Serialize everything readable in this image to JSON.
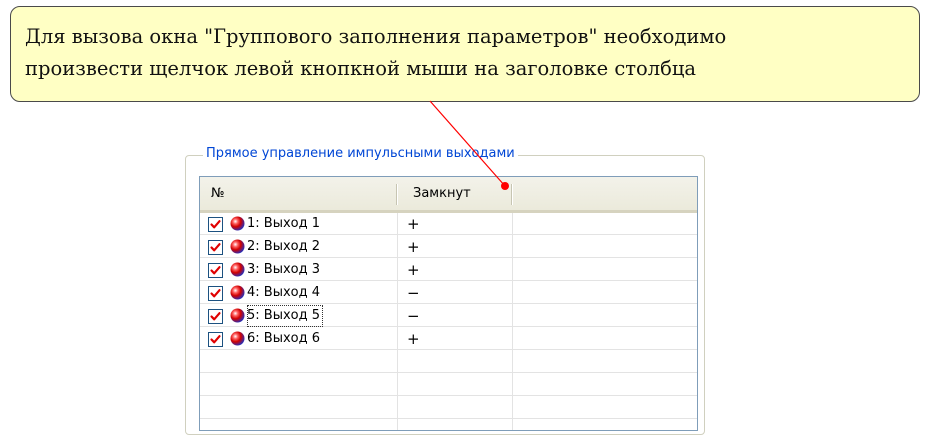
{
  "callout": {
    "line1": "Для вызова окна \"Группового заполнения параметров\" необходимо",
    "line2": "произвести щелчок левой кнопкной мыши на заголовке столбца",
    "background": "#ffffc4",
    "pointer_color": "#ff0000"
  },
  "groupbox": {
    "title": "Прямое управление импульсными выходами",
    "title_color": "#0046d5"
  },
  "grid": {
    "columns": [
      {
        "label": "№"
      },
      {
        "label": "Замкнут"
      }
    ],
    "rows": [
      {
        "checked": true,
        "icon": "status-ball-icon",
        "label": "1: Выход 1",
        "closed": "+"
      },
      {
        "checked": true,
        "icon": "status-ball-icon",
        "label": "2: Выход 2",
        "closed": "+"
      },
      {
        "checked": true,
        "icon": "status-ball-icon",
        "label": "3: Выход 3",
        "closed": "+"
      },
      {
        "checked": true,
        "icon": "status-ball-icon",
        "label": "4: Выход 4",
        "closed": "−"
      },
      {
        "checked": true,
        "icon": "status-ball-icon",
        "label": "5: Выход 5",
        "closed": "−",
        "focused": true
      },
      {
        "checked": true,
        "icon": "status-ball-icon",
        "label": "6: Выход 6",
        "closed": "+"
      }
    ]
  }
}
